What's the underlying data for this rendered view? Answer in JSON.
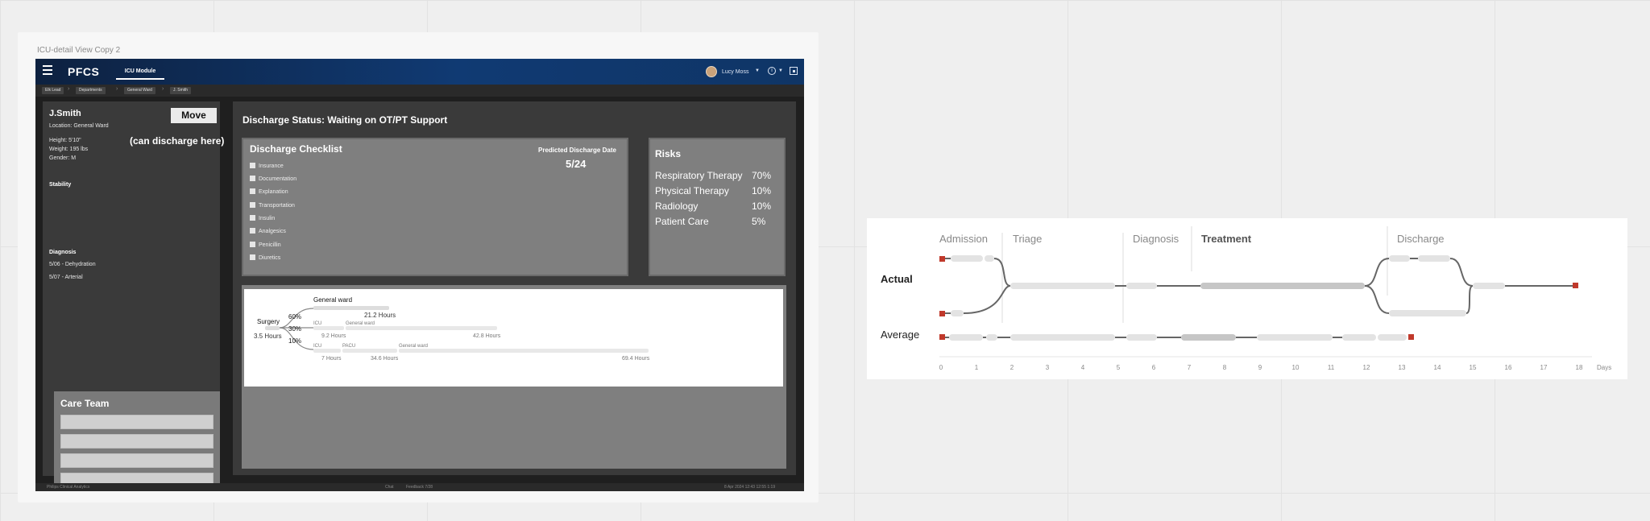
{
  "frame_label": "ICU-detail View Copy 2",
  "header": {
    "brand": "PFCS",
    "module_tab": "ICU Module",
    "user_name": "Lucy Moss"
  },
  "breadcrumbs": [
    "Elk Lead",
    "Departments",
    "General Ward",
    "J. Smith"
  ],
  "patient": {
    "name": "J.Smith",
    "location": "Location: General Ward",
    "height": "Height: 5'10\"",
    "weight": "Weight: 195 lbs",
    "gender": "Gender: M",
    "stability_label": "Stability",
    "diagnosis_label": "Diagnosis",
    "diagnoses": [
      "5/06 - Dehydration",
      "5/07 - Arterial"
    ],
    "move_button": "Move",
    "discharge_note": "(can discharge here)"
  },
  "care_team": {
    "title": "Care Team"
  },
  "discharge": {
    "status_title": "Discharge Status: Waiting on  OT/PT Support",
    "checklist_title": "Discharge Checklist",
    "predicted_label": "Predicted Discharge Date",
    "predicted_value": "5/24",
    "items": [
      "Insurance",
      "Documentation",
      "Explanation",
      "Transportation",
      "Insulin",
      "Analgesics",
      "Penicillin",
      "Diuretics"
    ]
  },
  "risks": {
    "title": "Risks",
    "items": [
      {
        "name": "Respiratory Therapy",
        "pct": "70%"
      },
      {
        "name": "Physical Therapy",
        "pct": "10%"
      },
      {
        "name": "Radiology",
        "pct": "10%"
      },
      {
        "name": "Patient Care",
        "pct": "5%"
      }
    ]
  },
  "pathway": {
    "start_label": "Surgery",
    "start_hours": "3.5 Hours",
    "branch_pcts": [
      "60%",
      "30%",
      "10%"
    ],
    "branch1": {
      "unit": "General ward",
      "hours": "21.2 Hours"
    },
    "branch2": {
      "units": [
        "ICU",
        "General ward"
      ],
      "hours": [
        "9.2 Hours",
        "42.8 Hours"
      ]
    },
    "branch3": {
      "units": [
        "ICU",
        "PACU",
        "General ward"
      ],
      "hours": [
        "7 Hours",
        "34.6 Hours",
        "69.4 Hours"
      ]
    }
  },
  "footer": {
    "left": "Philips Clinical Analytics",
    "center_a": "Chat",
    "center_b": "Feedback 7/28",
    "right": "8 Apr 2024  12:43     12:55  1:19"
  },
  "timeline": {
    "phases": [
      "Admission",
      "Triage",
      "Diagnosis",
      "Treatment",
      "Discharge"
    ],
    "rows": [
      "Actual",
      "Average"
    ],
    "x_ticks": [
      "0",
      "1",
      "2",
      "3",
      "4",
      "5",
      "6",
      "7",
      "8",
      "9",
      "10",
      "11",
      "12",
      "13",
      "14",
      "15",
      "16",
      "17",
      "18"
    ],
    "x_unit": "Days"
  }
}
